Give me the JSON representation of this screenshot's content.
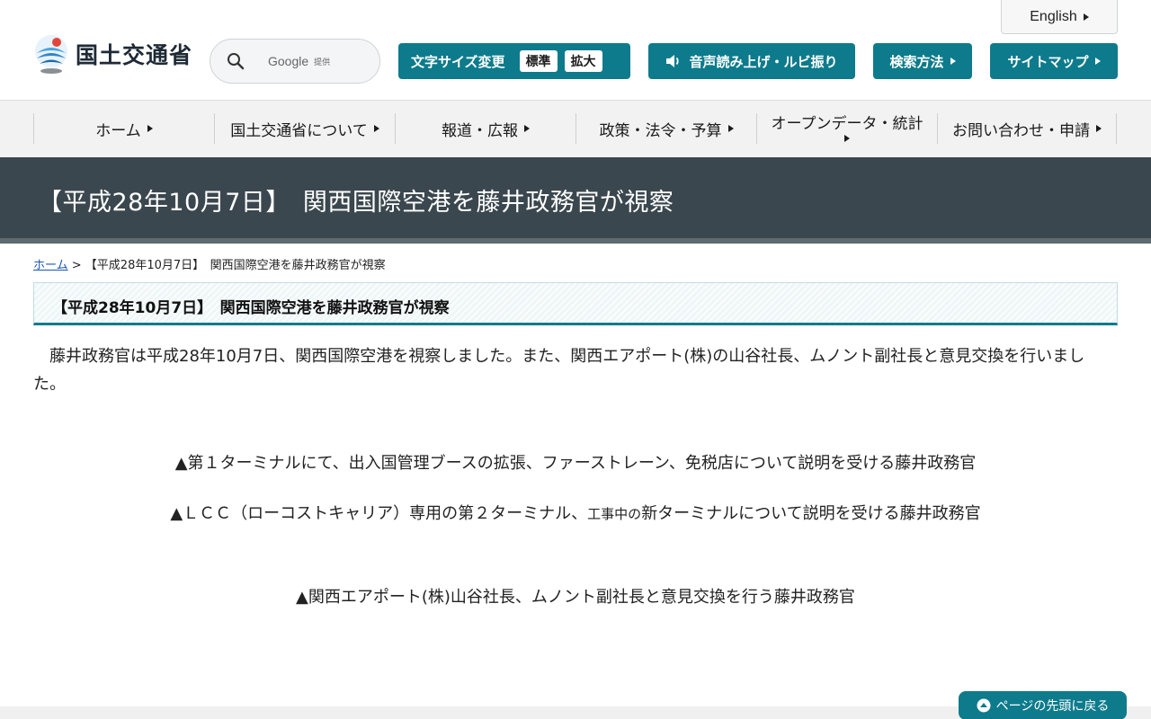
{
  "header": {
    "logo_text": "国土交通省",
    "search": {
      "brand": "Google",
      "sub": "提供"
    },
    "english_label": "English",
    "font_size": {
      "label": "文字サイズ変更",
      "standard": "標準",
      "large": "拡大"
    },
    "voice_label": "音声読み上げ・ルビ振り",
    "search_method_label": "検索方法",
    "sitemap_label": "サイトマップ"
  },
  "nav": {
    "items": [
      {
        "label": "ホーム"
      },
      {
        "label": "国土交通省について"
      },
      {
        "label": "報道・広報"
      },
      {
        "label": "政策・法令・予算"
      },
      {
        "label": "オープンデータ・統計"
      },
      {
        "label": "お問い合わせ・申請"
      }
    ]
  },
  "page": {
    "title": "【平成28年10月7日】　関西国際空港を藤井政務官が視察"
  },
  "breadcrumb": {
    "home": "ホーム",
    "separator": " > ",
    "current": "【平成28年10月7日】　関西国際空港を藤井政務官が視察"
  },
  "content": {
    "heading": "【平成28年10月7日】　関西国際空港を藤井政務官が視察",
    "body": "藤井政務官は平成28年10月7日、関西国際空港を視察しました。また、関西エアポート(株)の山谷社長、ムノント副社長と意見交換を行いました。",
    "caption1": "▲第１ターミナルにて、出入国管理ブースの拡張、ファーストレーン、免税店について説明を受ける藤井政務官",
    "caption2_a": "▲ＬＣＣ（ローコストキャリア）専用の第２ターミナル、",
    "caption2_b": "工事中の",
    "caption2_c": "新ターミナルについて説明を受ける藤井政務官",
    "caption3": "▲関西エアポート(株)山谷社長、ムノント副社長と意見交換を行う藤井政務官"
  },
  "footer": {
    "page_top_label": "ページの先頭に戻る"
  },
  "colors": {
    "accent": "#0d7b8c",
    "title_band": "#3b474e",
    "nav_bg": "#f2f2f2",
    "link": "#1a55b5"
  }
}
